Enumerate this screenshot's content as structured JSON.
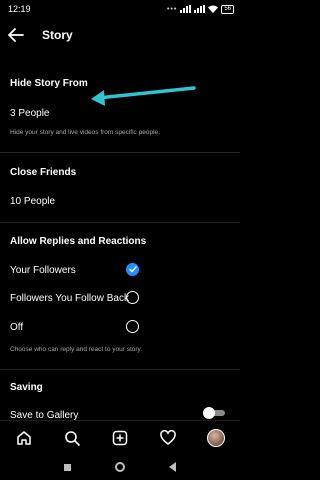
{
  "status": {
    "time": "12:19",
    "dots": "•••",
    "battery": "56"
  },
  "header": {
    "title": "Story"
  },
  "hide_story": {
    "title": "Hide Story From",
    "value": "3 People",
    "description": "Hide your story and live videos from specific people."
  },
  "close_friends": {
    "title": "Close Friends",
    "value": "10 People"
  },
  "replies": {
    "title": "Allow Replies and Reactions",
    "options": [
      {
        "label": "Your Followers",
        "selected": true
      },
      {
        "label": "Followers You Follow Back",
        "selected": false
      },
      {
        "label": "Off",
        "selected": false
      }
    ],
    "description": "Choose who can reply and react to your story."
  },
  "saving": {
    "title": "Saving",
    "save_to_gallery": "Save to Gallery",
    "save_to_gallery_on": false
  },
  "colors": {
    "accent": "#1e90ff",
    "annotation_arrow": "#2ec4d0",
    "background": "#000000"
  },
  "nav_icons": [
    "home-icon",
    "search-icon",
    "add-post-icon",
    "heart-icon",
    "profile-avatar"
  ]
}
